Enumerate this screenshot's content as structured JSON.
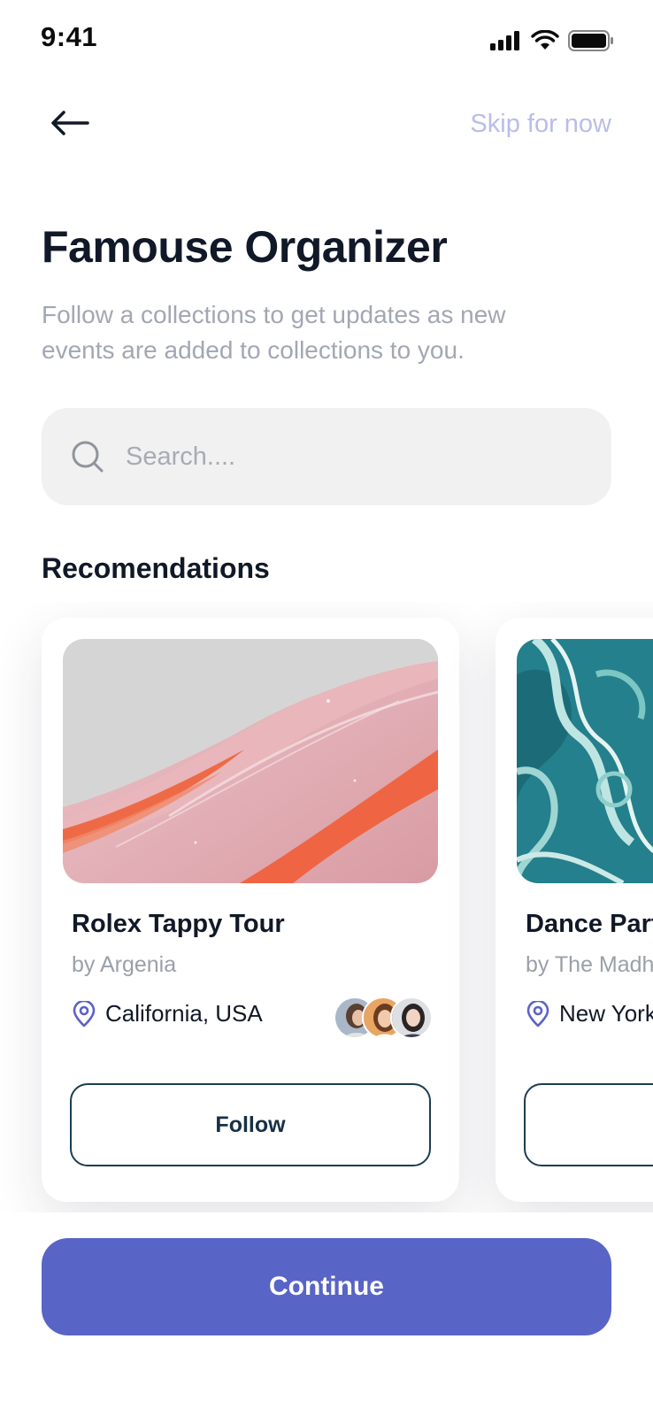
{
  "status_bar": {
    "time": "9:41"
  },
  "header": {
    "skip_label": "Skip for now"
  },
  "page": {
    "title": "Famouse Organizer",
    "subtitle": "Follow a collections to get updates as new events are added to collections to you."
  },
  "search": {
    "placeholder": "Search...."
  },
  "recommendations": {
    "title": "Recomendations",
    "cards": [
      {
        "title": "Rolex Tappy Tour",
        "organizer": "by Argenia",
        "location": "California, USA",
        "follow_label": "Follow"
      },
      {
        "title": "Dance Part",
        "organizer": "by The Madh",
        "location": "New York,",
        "follow_label": ""
      }
    ]
  },
  "footer": {
    "continue_label": "Continue"
  },
  "colors": {
    "accent": "#5864c6",
    "skip": "#b9bde9",
    "follow_border": "#1c3d52"
  }
}
